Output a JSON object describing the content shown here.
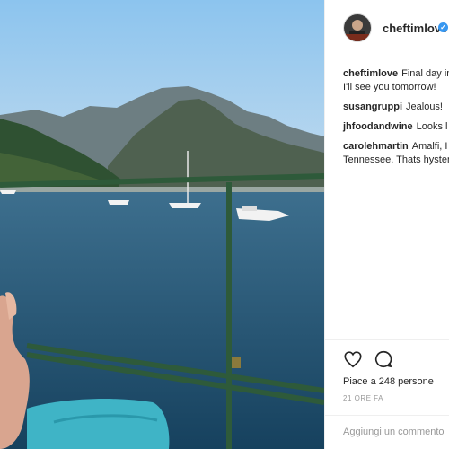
{
  "post": {
    "author": "cheftimlove",
    "verified_icon": "verified-badge-icon",
    "accent": "#3897f0"
  },
  "comments": [
    {
      "user": "cheftimlove",
      "text": "Final day in",
      "cont": "I'll see you tomorrow!"
    },
    {
      "user": "susangruppi",
      "text": "Jealous!",
      "cont": ""
    },
    {
      "user": "jhfoodandwine",
      "text": "Looks l",
      "cont": ""
    },
    {
      "user": "carolehmartin",
      "text": "Amalfi, I",
      "cont": "Tennessee. Thats hyster"
    }
  ],
  "actions": {
    "likes": "Piace a 248 persone",
    "time": "21 ORE FA",
    "add_comment_placeholder": "Aggiungi un commento"
  }
}
